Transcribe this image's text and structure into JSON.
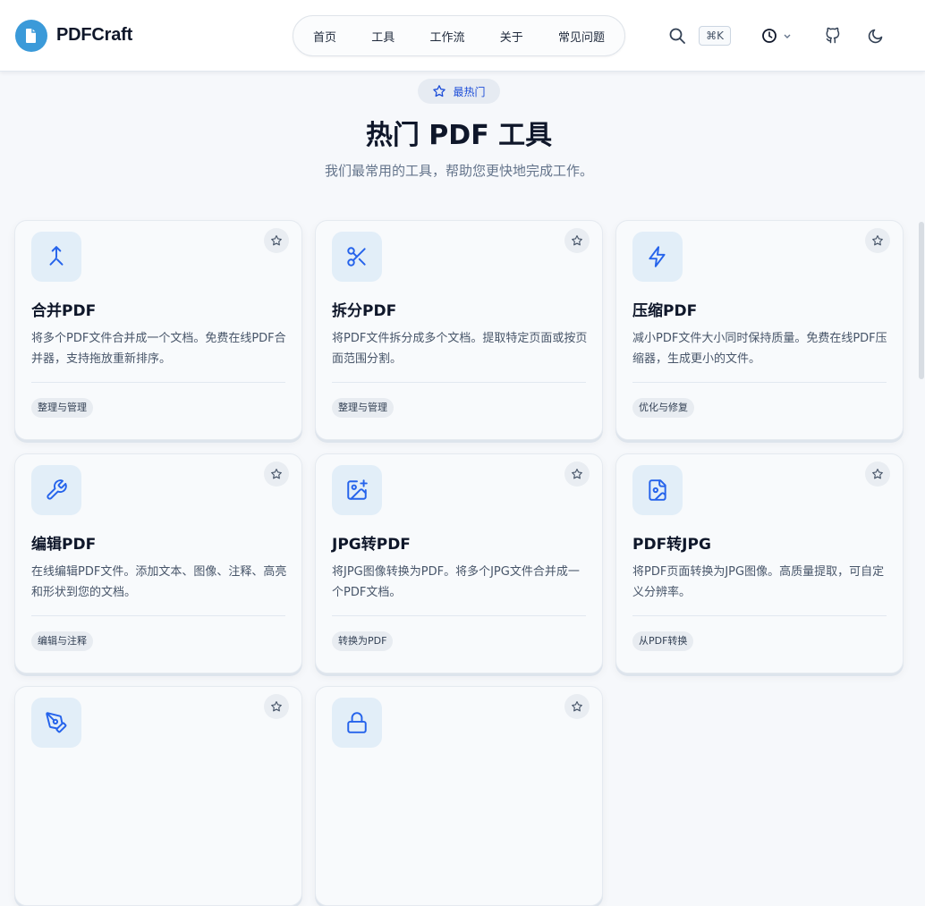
{
  "header": {
    "logo_text": "PDFCraft",
    "nav": [
      "首页",
      "工具",
      "工作流",
      "关于",
      "常见问题"
    ],
    "shortcut": "⌘K",
    "icons": [
      "search-icon",
      "clock-icon",
      "github-icon",
      "moon-icon"
    ]
  },
  "hero": {
    "badge": "最热门",
    "title": "热门 PDF 工具",
    "subtitle": "我们最常用的工具，帮助您更快地完成工作。"
  },
  "cards": [
    {
      "name": "合并PDF",
      "desc": "将多个PDF文件合并成一个文档。免费在线PDF合并器，支持拖放重新排序。",
      "tag": "整理与管理",
      "icon": "merge-icon"
    },
    {
      "name": "拆分PDF",
      "desc": "将PDF文件拆分成多个文档。提取特定页面或按页面范围分割。",
      "tag": "整理与管理",
      "icon": "scissors-icon"
    },
    {
      "name": "压缩PDF",
      "desc": "减小PDF文件大小同时保持质量。免费在线PDF压缩器，生成更小的文件。",
      "tag": "优化与修复",
      "icon": "lightning-icon"
    },
    {
      "name": "编辑PDF",
      "desc": "在线编辑PDF文件。添加文本、图像、注释、高亮和形状到您的文档。",
      "tag": "编辑与注释",
      "icon": "wrench-icon"
    },
    {
      "name": "JPG转PDF",
      "desc": "将JPG图像转换为PDF。将多个JPG文件合并成一个PDF文档。",
      "tag": "转换为PDF",
      "icon": "image-plus-icon"
    },
    {
      "name": "PDF转JPG",
      "desc": "将PDF页面转换为JPG图像。高质量提取，可自定义分辨率。",
      "tag": "从PDF转换",
      "icon": "file-image-icon"
    },
    {
      "name": "",
      "desc": "",
      "tag": "",
      "icon": "pen-tool-icon"
    },
    {
      "name": "",
      "desc": "",
      "tag": "",
      "icon": "lock-icon"
    }
  ],
  "colors": {
    "accent": "#2563eb",
    "logo_bg": "#3b9ad9",
    "icon_box": "#e2eef8"
  }
}
